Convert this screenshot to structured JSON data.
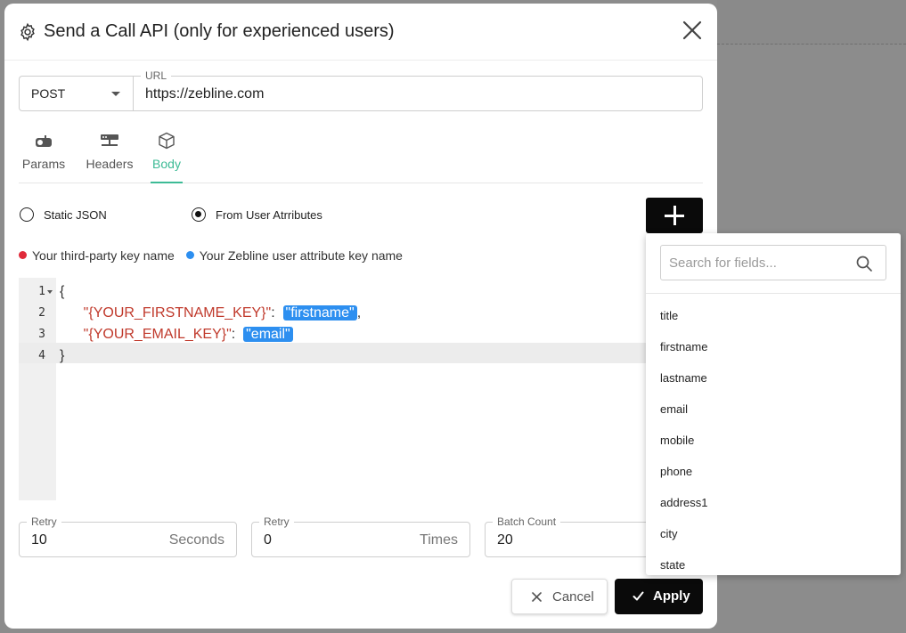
{
  "modal": {
    "title": "Send a Call API (only for experienced users)"
  },
  "request": {
    "method": "POST",
    "url_label": "URL",
    "url": "https://zebline.com"
  },
  "tabs": [
    {
      "label": "Params",
      "icon": "mailbox-icon",
      "active": false
    },
    {
      "label": "Headers",
      "icon": "network-icon",
      "active": false
    },
    {
      "label": "Body",
      "icon": "cube-icon",
      "active": true
    }
  ],
  "body_mode": {
    "static_json_label": "Static JSON",
    "from_attributes_label": "From User Atrributes",
    "selected": "From User Atrributes"
  },
  "legend": {
    "third_party": "Your third-party key name",
    "zebline": "Your Zebline user attribute key name"
  },
  "editor": {
    "lines": [
      {
        "num": "1",
        "open": "{"
      },
      {
        "num": "2",
        "key": "\"{YOUR_FIRSTNAME_KEY}\"",
        "sep": ":",
        "value": "\"firstname\"",
        "trail": ","
      },
      {
        "num": "3",
        "key": "\"{YOUR_EMAIL_KEY}\"",
        "sep": ":",
        "value": "\"email\"",
        "trail": ""
      },
      {
        "num": "4",
        "close": "}"
      }
    ]
  },
  "retry_seconds": {
    "label": "Retry",
    "value": "10",
    "unit": "Seconds"
  },
  "retry_times": {
    "label": "Retry",
    "value": "0",
    "unit": "Times"
  },
  "batch_count": {
    "label": "Batch Count",
    "value": "20"
  },
  "actions": {
    "cancel_label": "Cancel",
    "apply_label": "Apply"
  },
  "field_picker": {
    "search_placeholder": "Search for fields...",
    "fields": [
      "title",
      "firstname",
      "lastname",
      "email",
      "mobile",
      "phone",
      "address1",
      "city",
      "state"
    ]
  },
  "colors": {
    "accent_green": "#3dbb96",
    "third_party_red": "#e02a3a",
    "zebline_blue": "#2d8ff0"
  }
}
